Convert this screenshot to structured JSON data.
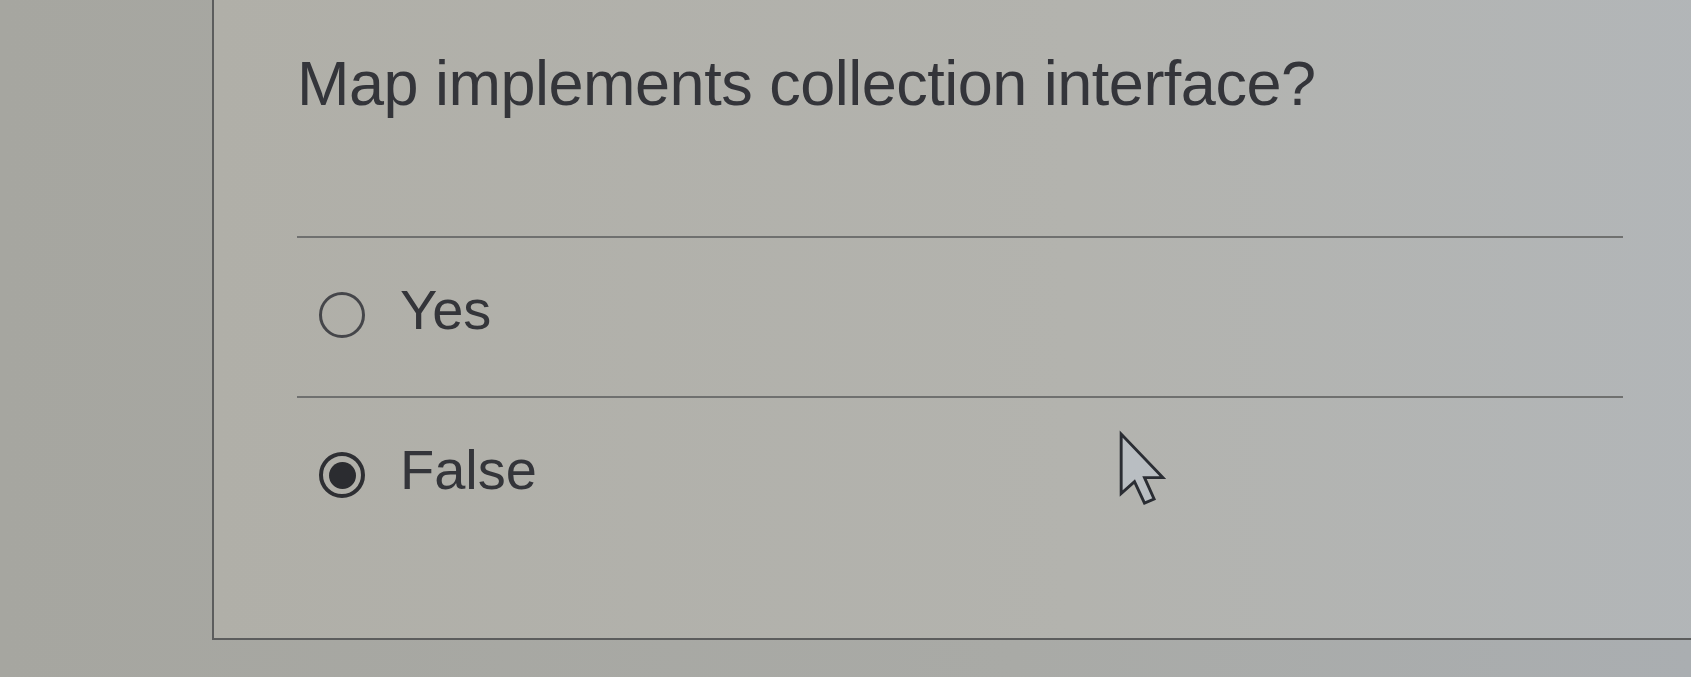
{
  "question": {
    "text": "Map implements collection interface?"
  },
  "options": [
    {
      "label": "Yes",
      "selected": false
    },
    {
      "label": "False",
      "selected": true
    }
  ]
}
